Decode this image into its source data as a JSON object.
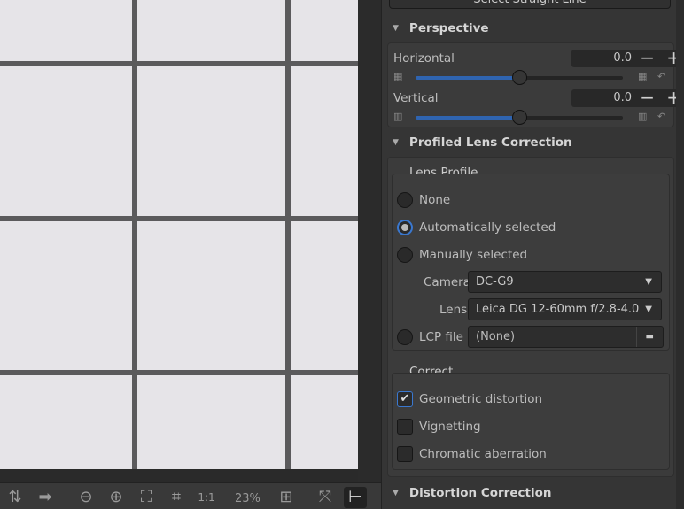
{
  "toolbar": {
    "zoom_level": "23%"
  },
  "panel": {
    "top_button": "Select Straight Line",
    "perspective": {
      "title": "Perspective",
      "horizontal": {
        "label": "Horizontal",
        "value": "0.0",
        "fraction": 0.5
      },
      "vertical": {
        "label": "Vertical",
        "value": "0.0",
        "fraction": 0.5
      }
    },
    "plc": {
      "title": "Profiled Lens Correction",
      "lens_profile_title": "Lens Profile",
      "options": [
        "None",
        "Automatically selected",
        "Manually selected"
      ],
      "selected": "Automatically selected",
      "camera_label": "Camera",
      "camera_value": "DC-G9",
      "lens_label": "Lens",
      "lens_value": "Leica DG 12-60mm f/2.8-4.0",
      "lcp_label": "LCP file",
      "lcp_value": "(None)",
      "correct_title": "Correct",
      "checks": [
        {
          "label": "Geometric distortion",
          "checked": true
        },
        {
          "label": "Vignetting",
          "checked": false
        },
        {
          "label": "Chromatic aberration",
          "checked": false
        }
      ]
    },
    "distortion": {
      "title": "Distortion Correction"
    }
  },
  "colors": {
    "accent": "#2f64b0"
  }
}
